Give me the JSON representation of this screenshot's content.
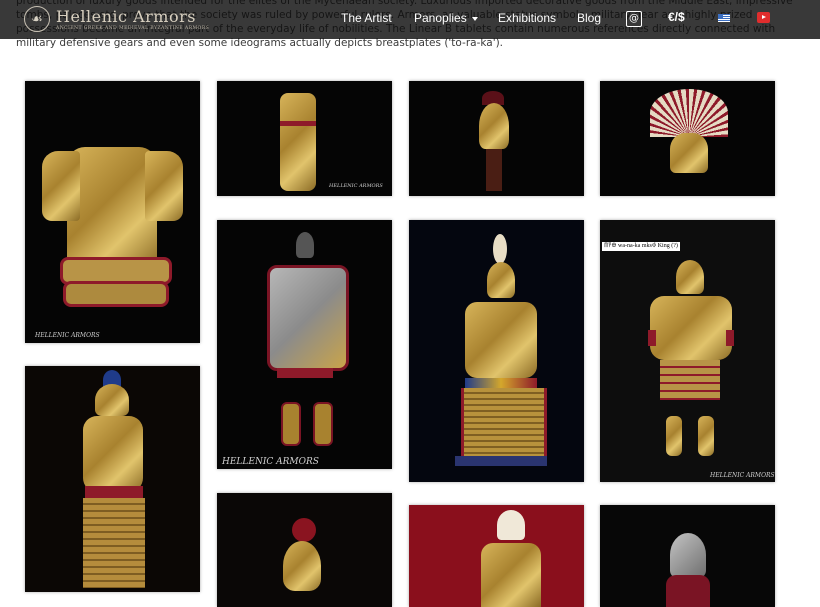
{
  "intro_text": "production of luxury goods intended for the elites of the Mycenaean society. Luxurious imported decorative goods from the Middle East, impressive tombs, palaces etc. prove that the society was ruled by powerful rulers. Armors, as valuable status symbols, military gear and highly prized possessions became an integral part of the everyday life of nobilities. The Linear B tablets contain numerous references directly connected with military defensive gears and even some ideograms actually depicts breastplates ('to-ra-ka').",
  "nav": {
    "logo_emblem": "☙",
    "logo_title": "Hellenic Armors",
    "logo_subtitle": "Ancient Greek and Medieval Byzantine Armors",
    "items": [
      {
        "label": "The Artist"
      },
      {
        "label": "Panoplies"
      },
      {
        "label": "Exhibitions"
      },
      {
        "label": "Blog"
      }
    ],
    "contact_icon": "@",
    "currency": "€/$"
  },
  "gallery": {
    "watermark": "HELLENIC ARMORS",
    "ideogram_label": "𐀷𐀙𐀏 wa-na-ka mks𐀶 King (?)"
  },
  "colors": {
    "navbar_bg": "#0e0e0e",
    "photo_bg": "#050505",
    "gold": "#c9a44a",
    "crimson": "#8e1a2a",
    "red_backdrop": "#8a0f1c"
  }
}
